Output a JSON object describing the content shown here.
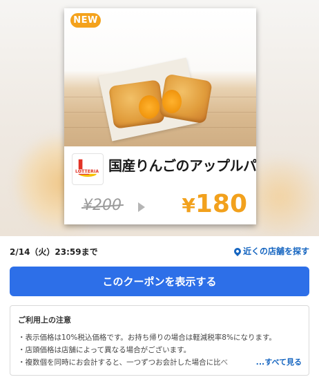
{
  "coupon": {
    "badge": "NEW",
    "logo_text": "LOTTERIA",
    "product_name": "国産りんごのアップルパイ",
    "old_price": "¥200",
    "new_price_symbol": "¥",
    "new_price_value": "180"
  },
  "info": {
    "deadline": "2/14（火）23:59まで",
    "nearby_link": "近くの店舗を探す"
  },
  "cta": {
    "label": "このクーポンを表示する"
  },
  "notes": {
    "title": "ご利用上の注意",
    "lines": [
      "・表示価格は10%税込価格です。お持ち帰りの場合は軽減税率8%になります。",
      "・店頭価格は店舗によって異なる場合がございます。",
      "・複数個を同時にお会計すると、一つずつお会計した場合に比べ"
    ],
    "see_all": "...すべて見る"
  },
  "colors": {
    "accent_price": "#f2a11d",
    "badge": "#f4a21c",
    "cta": "#2d6fe8",
    "link": "#1565c0",
    "brand_red": "#e23326"
  },
  "icons": [
    "map-pin-icon",
    "chevron-right-icon",
    "lotteria-logo"
  ]
}
